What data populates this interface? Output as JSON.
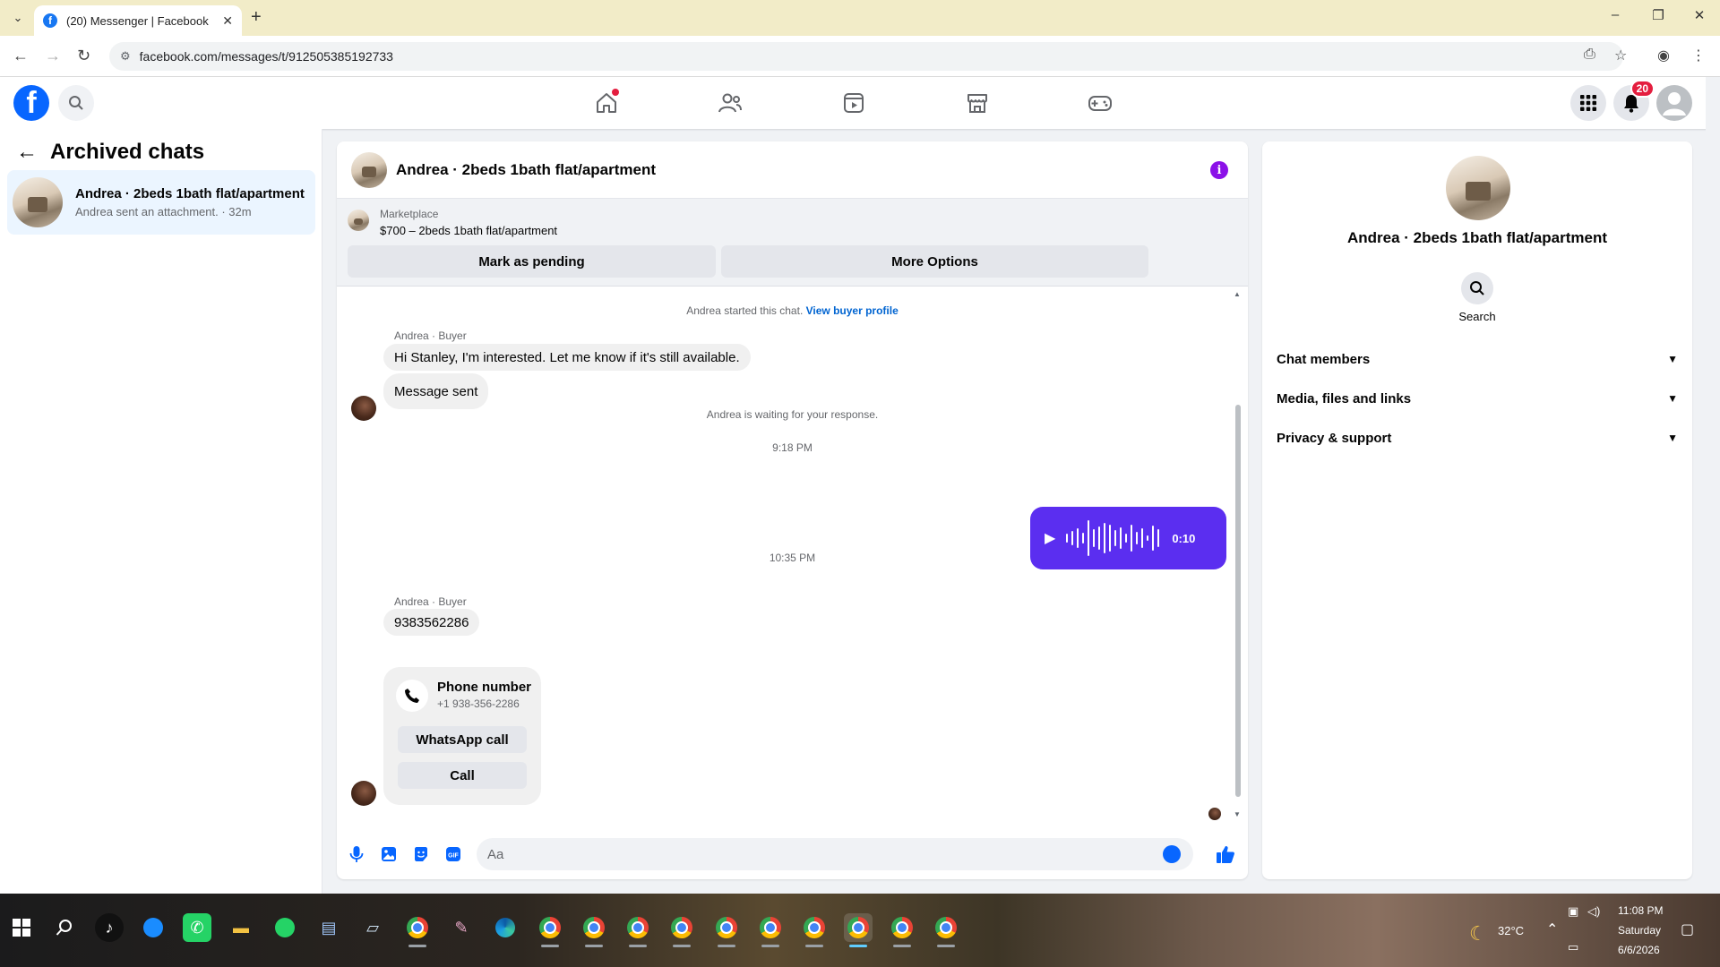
{
  "browser": {
    "tab_title": "(20) Messenger | Facebook",
    "url": "facebook.com/messages/t/912505385192733",
    "new_tab": "+",
    "close_tab": "✕"
  },
  "fb_header": {
    "notification_count": "20"
  },
  "sidebar": {
    "title": "Archived chats",
    "chats": [
      {
        "name": "Andrea · 2beds 1bath flat/apartment",
        "preview": "Andrea sent an attachment. · 32m"
      }
    ]
  },
  "chat": {
    "title": "Andrea · 2beds 1bath flat/apartment",
    "marketplace": {
      "label": "Marketplace",
      "listing": "$700 – 2beds 1bath flat/apartment",
      "pending_button": "Mark as pending",
      "options_button": "More Options"
    },
    "started_text": "Andrea started this chat.",
    "view_profile": "View buyer profile",
    "sender_1": "Andrea · Buyer",
    "msg_1": "Hi Stanley, I'm interested. Let me know if it's still available.",
    "msg_2": "Message sent",
    "waiting_text": "Andrea is waiting for your response.",
    "time_1": "9:18 PM",
    "audio_duration": "0:10",
    "time_2": "10:35 PM",
    "sender_2": "Andrea · Buyer",
    "msg_3": "9383562286",
    "phone_card": {
      "title": "Phone number",
      "number": "+1 938-356-2286",
      "whatsapp_button": "WhatsApp call",
      "call_button": "Call"
    },
    "composer_placeholder": "Aa"
  },
  "info_panel": {
    "name": "Andrea · 2beds 1bath flat/apartment",
    "search_label": "Search",
    "sections": [
      "Chat members",
      "Media, files and links",
      "Privacy & support"
    ]
  },
  "taskbar": {
    "weather": "32°C",
    "time": "11:08 PM",
    "day": "Saturday",
    "date": "6/6/2026"
  },
  "colors": {
    "fb_blue": "#0866ff",
    "audio_bubble": "#5b2ef0",
    "info_icon": "#8b11e8",
    "badge_red": "#e41e3f"
  }
}
